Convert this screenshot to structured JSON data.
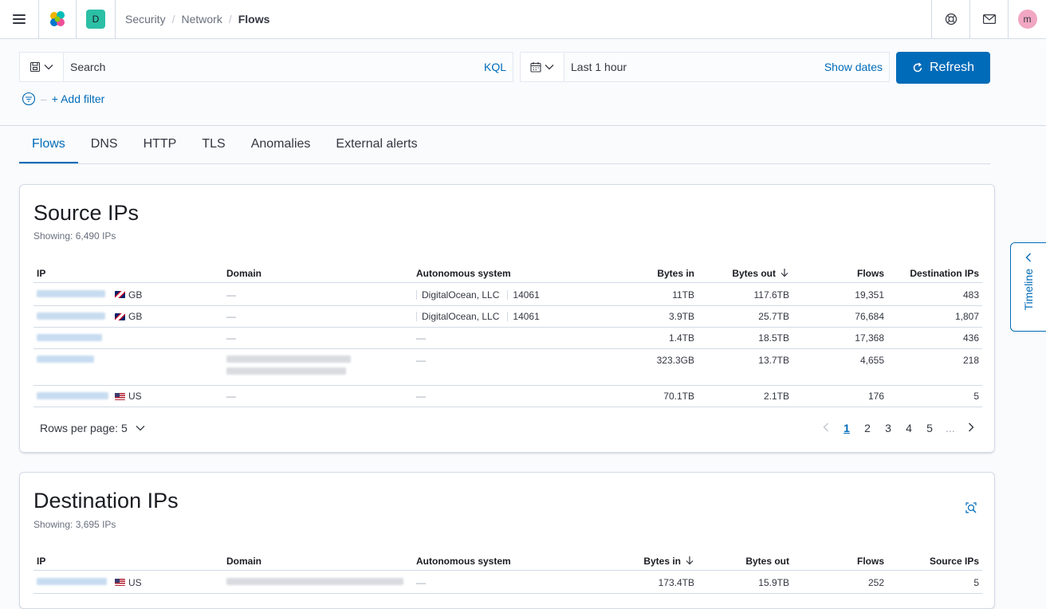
{
  "header": {
    "space_initial": "D",
    "breadcrumbs": [
      "Security",
      "Network",
      "Flows"
    ],
    "avatar_initial": "m"
  },
  "query_bar": {
    "search_placeholder": "Search",
    "language_label": "KQL",
    "time_range": "Last 1 hour",
    "show_dates_label": "Show dates",
    "refresh_label": "Refresh",
    "add_filter_label": "+ Add filter"
  },
  "tabs": [
    "Flows",
    "DNS",
    "HTTP",
    "TLS",
    "Anomalies",
    "External alerts"
  ],
  "selected_tab": "Flows",
  "source_ips": {
    "title": "Source IPs",
    "showing": "Showing: 6,490 IPs",
    "columns": [
      "IP",
      "Domain",
      "Autonomous system",
      "Bytes in",
      "Bytes out",
      "Flows",
      "Destination IPs"
    ],
    "sorted_column": "Bytes out",
    "rows": [
      {
        "country": "GB",
        "flag": "gb",
        "domain": "—",
        "as_name": "DigitalOcean, LLC",
        "as_number": "14061",
        "bytes_in": "11TB",
        "bytes_out": "117.6TB",
        "flows": "19,351",
        "dest_ips": "483"
      },
      {
        "country": "GB",
        "flag": "gb",
        "domain": "—",
        "as_name": "DigitalOcean, LLC",
        "as_number": "14061",
        "bytes_in": "3.9TB",
        "bytes_out": "25.7TB",
        "flows": "76,684",
        "dest_ips": "1,807"
      },
      {
        "country": "",
        "flag": "",
        "domain": "—",
        "as_name": "—",
        "as_number": "",
        "bytes_in": "1.4TB",
        "bytes_out": "18.5TB",
        "flows": "17,368",
        "dest_ips": "436"
      },
      {
        "country": "",
        "flag": "",
        "domain": "",
        "as_name": "—",
        "as_number": "",
        "bytes_in": "323.3GB",
        "bytes_out": "13.7TB",
        "flows": "4,655",
        "dest_ips": "218"
      },
      {
        "country": "US",
        "flag": "us",
        "domain": "—",
        "as_name": "—",
        "as_number": "",
        "bytes_in": "70.1TB",
        "bytes_out": "2.1TB",
        "flows": "176",
        "dest_ips": "5"
      }
    ],
    "rows_per_page": "Rows per page: 5",
    "pages": [
      "1",
      "2",
      "3",
      "4",
      "5",
      "..."
    ],
    "current_page": "1"
  },
  "destination_ips": {
    "title": "Destination IPs",
    "showing": "Showing: 3,695 IPs",
    "columns": [
      "IP",
      "Domain",
      "Autonomous system",
      "Bytes in",
      "Bytes out",
      "Flows",
      "Source IPs"
    ],
    "sorted_column": "Bytes in",
    "rows": [
      {
        "country": "US",
        "flag": "us",
        "domain": "",
        "as_name": "—",
        "bytes_in": "173.4TB",
        "bytes_out": "15.9TB",
        "flows": "252",
        "src_ips": "5"
      }
    ]
  },
  "timeline_label": "Timeline",
  "colors": {
    "accent": "#006bb8",
    "space_badge": "#2bbfa5",
    "avatar": "#f1a6c2"
  }
}
